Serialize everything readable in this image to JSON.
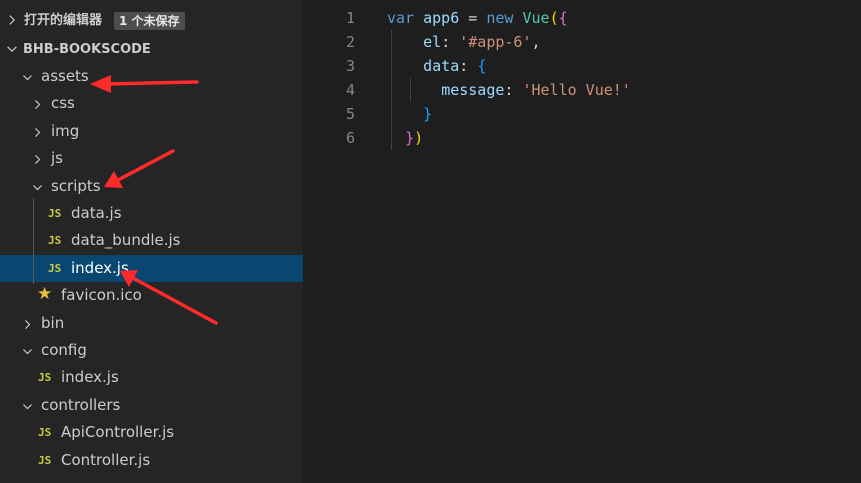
{
  "sidebar": {
    "open_editors": {
      "title": "打开的编辑器",
      "badge": "1 个未保存"
    },
    "project": {
      "title": "BHB-BOOKSCODE"
    },
    "tree": [
      {
        "label": "assets",
        "kind": "folder",
        "expanded": true
      },
      {
        "label": "css",
        "kind": "folder",
        "expanded": false
      },
      {
        "label": "img",
        "kind": "folder",
        "expanded": false
      },
      {
        "label": "js",
        "kind": "folder",
        "expanded": false
      },
      {
        "label": "scripts",
        "kind": "folder",
        "expanded": true
      },
      {
        "label": "data.js",
        "kind": "js-file"
      },
      {
        "label": "data_bundle.js",
        "kind": "js-file"
      },
      {
        "label": "index.js",
        "kind": "js-file",
        "selected": true
      },
      {
        "label": "favicon.ico",
        "kind": "ico-file"
      },
      {
        "label": "bin",
        "kind": "folder",
        "expanded": false
      },
      {
        "label": "config",
        "kind": "folder",
        "expanded": true
      },
      {
        "label": "index.js",
        "kind": "js-file"
      },
      {
        "label": "controllers",
        "kind": "folder",
        "expanded": true
      },
      {
        "label": "ApiController.js",
        "kind": "js-file"
      },
      {
        "label": "Controller.js",
        "kind": "js-file"
      }
    ],
    "js_icon_text": "JS"
  },
  "editor": {
    "line_numbers": [
      "1",
      "2",
      "3",
      "4",
      "5",
      "6"
    ],
    "lines": [
      [
        {
          "t": "var",
          "c": "kw"
        },
        {
          "t": " "
        },
        {
          "t": "app6",
          "c": "var"
        },
        {
          "t": " = "
        },
        {
          "t": "new",
          "c": "kw"
        },
        {
          "t": " "
        },
        {
          "t": "Vue",
          "c": "fn"
        },
        {
          "t": "(",
          "c": "p1"
        },
        {
          "t": "{",
          "c": "p2"
        }
      ],
      [
        {
          "t": "    "
        },
        {
          "t": "el",
          "c": "var"
        },
        {
          "t": ": "
        },
        {
          "t": "'#app-6'",
          "c": "str"
        },
        {
          "t": ","
        }
      ],
      [
        {
          "t": "    "
        },
        {
          "t": "data",
          "c": "var"
        },
        {
          "t": ": "
        },
        {
          "t": "{",
          "c": "p3"
        }
      ],
      [
        {
          "t": "      "
        },
        {
          "t": "message",
          "c": "var"
        },
        {
          "t": ": "
        },
        {
          "t": "'Hello Vue!'",
          "c": "str"
        }
      ],
      [
        {
          "t": "    "
        },
        {
          "t": "}",
          "c": "p3"
        }
      ],
      [
        {
          "t": "  "
        },
        {
          "t": "}",
          "c": "p2"
        },
        {
          "t": ")",
          "c": "p1"
        }
      ]
    ]
  },
  "colors": {
    "annotation_arrow": "#ff2a2a",
    "selection": "#094771",
    "js_icon": "#cbcb41",
    "ico_star": "#e8c13d"
  },
  "icons": {
    "folder_collapsed": "chevron-right-icon",
    "folder_expanded": "chevron-down-icon",
    "favicon": "star-icon"
  }
}
